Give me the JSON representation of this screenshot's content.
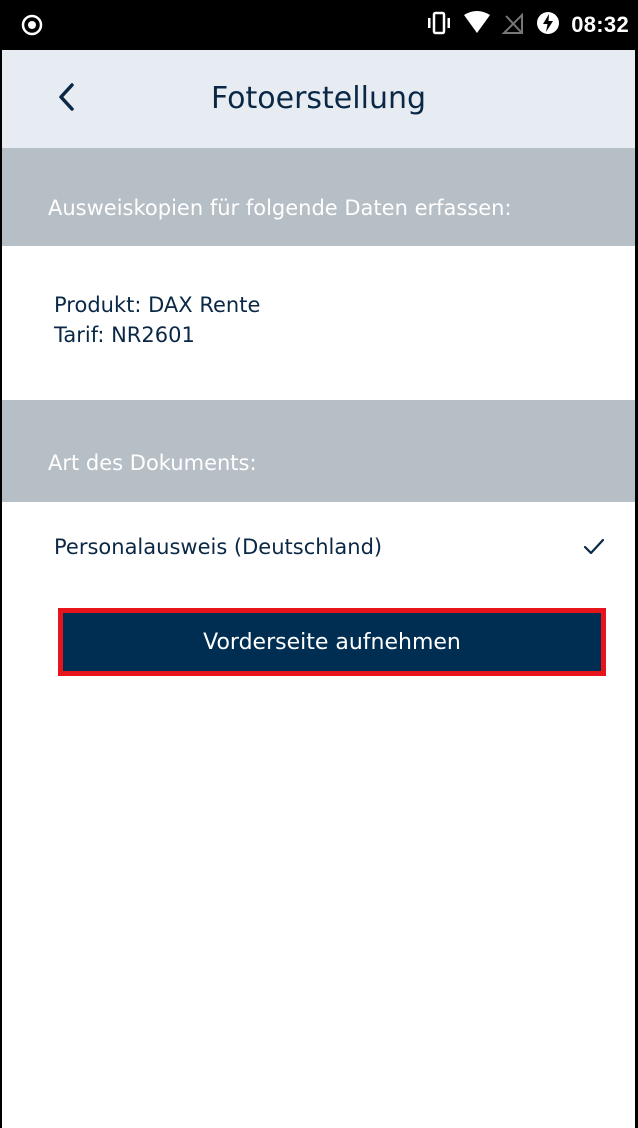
{
  "status_bar": {
    "time": "08:32",
    "icons": [
      "record-icon",
      "vibrate-icon",
      "wifi-icon",
      "no-signal-icon",
      "battery-charging-icon"
    ]
  },
  "app_bar": {
    "title": "Fotoerstellung",
    "back_icon": "chevron-left-icon"
  },
  "sections": {
    "capture_header": "Ausweiskopien für folgende Daten erfassen:",
    "product_line": "Produkt: DAX Rente",
    "tariff_line": "Tarif: NR2601",
    "document_header": "Art des Dokuments:"
  },
  "document": {
    "selected_label": "Personalausweis (Deutschland)",
    "check_icon": "checkmark-icon"
  },
  "actions": {
    "capture_front_label": "Vorderseite aufnehmen"
  },
  "colors": {
    "navy": "#002e52",
    "text": "#0a2845",
    "header_grey": "#b6bec6",
    "appbar_bg": "#e6ecf2",
    "highlight_red": "#e8141c"
  }
}
